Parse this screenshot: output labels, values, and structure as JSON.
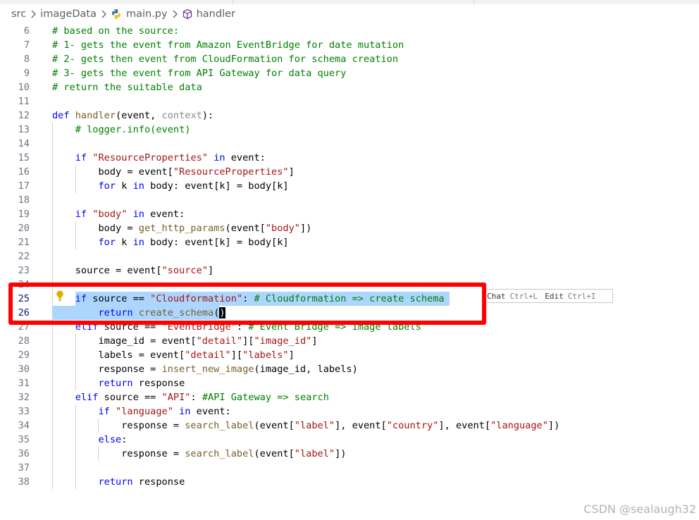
{
  "breadcrumb": {
    "items": [
      "src",
      "imageData",
      "main.py",
      "handler"
    ]
  },
  "editor": {
    "lines": [
      {
        "n": "6",
        "text": "# based on the source:"
      },
      {
        "n": "7",
        "text": "# 1- gets the event from Amazon EventBridge for date mutation"
      },
      {
        "n": "8",
        "text": "# 2- gets then event from CloudFormation for schema creation"
      },
      {
        "n": "9",
        "text": "# 3- gets the event from API Gateway for data query"
      },
      {
        "n": "10",
        "text": "# return the suitable data"
      },
      {
        "n": "11",
        "text": ""
      },
      {
        "n": "12",
        "text": "def handler(event, context):"
      },
      {
        "n": "13",
        "text": "    # logger.info(event)"
      },
      {
        "n": "14",
        "text": ""
      },
      {
        "n": "15",
        "text": "    if \"ResourceProperties\" in event:"
      },
      {
        "n": "16",
        "text": "        body = event[\"ResourceProperties\"]"
      },
      {
        "n": "17",
        "text": "        for k in body: event[k] = body[k]"
      },
      {
        "n": "18",
        "text": ""
      },
      {
        "n": "19",
        "text": "    if \"body\" in event:"
      },
      {
        "n": "20",
        "text": "        body = get_http_params(event[\"body\"])"
      },
      {
        "n": "21",
        "text": "        for k in body: event[k] = body[k]"
      },
      {
        "n": "22",
        "text": ""
      },
      {
        "n": "23",
        "text": "    source = event[\"source\"]"
      },
      {
        "n": "24",
        "text": ""
      },
      {
        "n": "25",
        "text": "    if source == \"Cloudformation\": # Cloudformation => create schema"
      },
      {
        "n": "26",
        "text": "        return create_schema()"
      },
      {
        "n": "27",
        "text": "    elif source == \"EventBridge\": # Event Bridge => image labels"
      },
      {
        "n": "28",
        "text": "        image_id = event[\"detail\"][\"image_id\"]"
      },
      {
        "n": "29",
        "text": "        labels = event[\"detail\"][\"labels\"]"
      },
      {
        "n": "30",
        "text": "        response = insert_new_image(image_id, labels)"
      },
      {
        "n": "31",
        "text": "        return response"
      },
      {
        "n": "32",
        "text": "    elif source == \"API\": #API Gateway => search"
      },
      {
        "n": "33",
        "text": "        if \"language\" in event:"
      },
      {
        "n": "34",
        "text": "            response = search_label(event[\"label\"], event[\"country\"], event[\"language\"])"
      },
      {
        "n": "35",
        "text": "        else:"
      },
      {
        "n": "36",
        "text": "            response = search_label(event[\"label\"])"
      },
      {
        "n": "37",
        "text": ""
      },
      {
        "n": "38",
        "text": "        return response"
      }
    ]
  },
  "inline_hint": {
    "chat_label": "Chat",
    "chat_key": "Ctrl+L",
    "edit_label": "Edit",
    "edit_key": "Ctrl+I"
  },
  "watermark": "CSDN @sealaugh32",
  "colors": {
    "comment": "#008000",
    "keyword": "#0000ff",
    "string": "#a31515",
    "function": "#795e26",
    "selection": "#add6ff",
    "annotation_box": "#ff0000"
  }
}
